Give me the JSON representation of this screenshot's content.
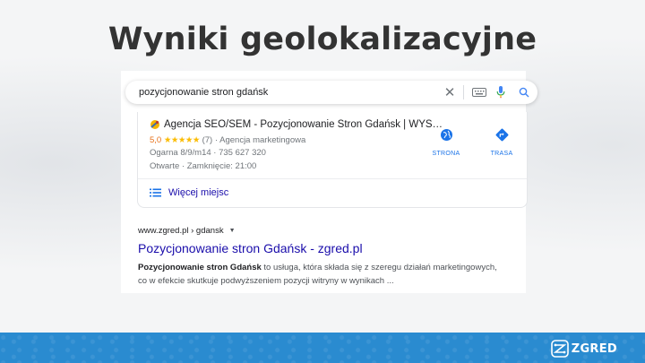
{
  "slide": {
    "title": "Wyniki geolokalizacyjne"
  },
  "search": {
    "query": "pozycjonowanie stron gdańsk"
  },
  "local_pack": {
    "business_name": "Agencja SEO/SEM - Pozycjonowanie Stron Gdańsk | WYS…",
    "rating": "5,0",
    "stars": "★★★★★",
    "reviews": "(7)",
    "category": "· Agencja marketingowa",
    "address": "Ogarna 8/9/m14 · 735 627 320",
    "hours": "Otwarte · Zamknięcie: 21:00",
    "website_label": "STRONA",
    "directions_label": "TRASA",
    "more_places": "Więcej miejsc"
  },
  "organic_result": {
    "breadcrumb": "www.zgred.pl › gdansk",
    "title": "Pozycjonowanie stron Gdańsk - zgred.pl",
    "snippet_bold": "Pozycjonowanie stron Gdańsk",
    "snippet_rest_line1": " to usługa, która składa się z szeregu działań marketingowych,",
    "snippet_line2": "co w efekcie skutkuje podwyższeniem pozycji witryny w wynikach ..."
  },
  "footer": {
    "brand": "ZGRED"
  },
  "colors": {
    "link_blue": "#1a0dab",
    "action_blue": "#1a73e8",
    "star_yellow": "#fbbc04",
    "footer_blue": "#2a8bd0",
    "title_gray": "#333333"
  },
  "icons": {
    "clear": "close-icon",
    "keyboard": "keyboard-icon",
    "mic": "microphone-icon",
    "lens": "search-icon",
    "website": "globe-icon",
    "directions": "directions-icon",
    "list": "list-icon"
  }
}
